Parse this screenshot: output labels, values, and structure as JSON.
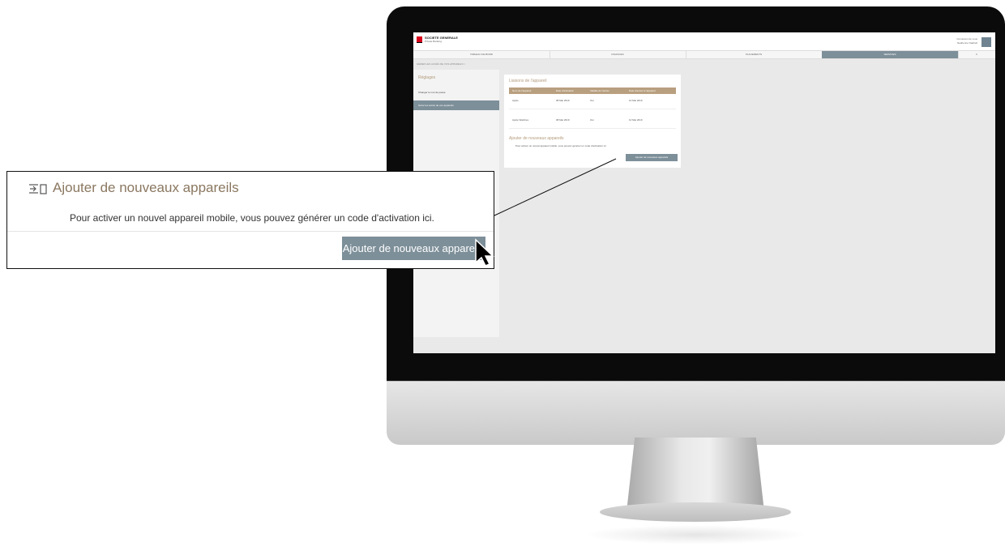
{
  "screen": {
    "brand": "SOCIETE GENERALE",
    "brand_sub": "Private Banking",
    "user_line1": "Connexion de vous",
    "user_line2": "Nadrienne Nadtrell",
    "nav": [
      "TABLEAU DE BORD",
      "FINANCES",
      "PLACEMENTS",
      "SERVICES",
      "≡"
    ],
    "active_nav": "SERVICES",
    "breadcrumb": "GÉRER LES ACCÈS DE VOS APPAREILS  >",
    "side_title": "Réglages",
    "side_items": [
      "Changer le mot de passe",
      "Gérer les accès de vos appareils"
    ],
    "card_title": "Liaisons de l'appareil",
    "table_headers": [
      "Nom de l'appareil",
      "Date d'activation",
      "Validité de l'accès",
      "Date d'accès à l'appareil"
    ],
    "table_rows": [
      [
        "Apple",
        "08 Mai 2019",
        "Oui",
        "10 Mai 2019"
      ],
      [
        "Apple Watches",
        "08 Mai 2019",
        "Oui",
        "10 Mai 2019"
      ]
    ],
    "add_title": "Ajouter de nouveaux appareils",
    "add_text": "Pour activer un nouvel appareil mobile, vous pouvez générer un code d'activation ici.",
    "add_button": "Ajouter de nouveaux appareils"
  },
  "callout": {
    "icon": "add-device-icon",
    "title": "Ajouter de nouveaux appareils",
    "text": "Pour activer un nouvel appareil mobile, vous pouvez générer un code d'activation ici.",
    "button": "Ajouter de nouveaux appareils"
  },
  "colors": {
    "accent_gold": "#b39b7b",
    "button_slate": "#7d8f99",
    "brand_red": "#d9001b"
  }
}
